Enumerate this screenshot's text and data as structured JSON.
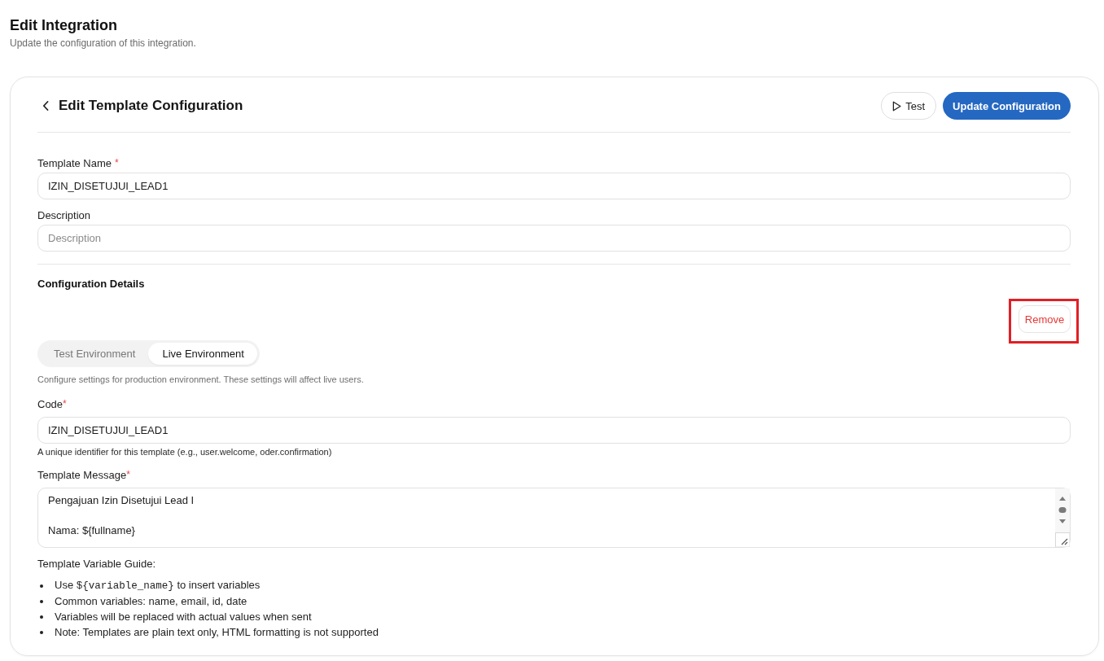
{
  "page": {
    "title": "Edit Integration",
    "subtitle": "Update the configuration of this integration."
  },
  "card": {
    "title": "Edit Template Configuration",
    "buttons": [
      {
        "kind": "test",
        "label": "Test"
      },
      {
        "kind": "primary",
        "label": "Update Configuration"
      }
    ],
    "fields": [
      {
        "label": "Template Name",
        "required_mark": "*",
        "value": "IZIN_DISETUJUI_LEAD1"
      },
      {
        "label": "Description",
        "placeholder": "Description"
      }
    ],
    "configuration": {
      "heading": "Configuration Details",
      "remove_button": {
        "label": "Remove",
        "highlighted": true
      },
      "environment_tabs": [
        {
          "label": "Test Environment",
          "selected": false
        },
        {
          "label": "Live Environment",
          "selected": true
        }
      ],
      "environment_note": "Configure settings for production environment. These settings will affect live users.",
      "code": {
        "label": "Code",
        "required_mark": "*",
        "value": "IZIN_DISETUJUI_LEAD1",
        "hint": "A unique identifier for this template (e.g., user.welcome, oder.confirmation)"
      },
      "template_message": {
        "label": "Template Message",
        "required_mark": "*",
        "value": "Pengajuan Izin Disetujui Lead I\n\nNama: ${fullname}"
      },
      "variable_guide": {
        "heading": "Template Variable Guide:",
        "items": [
          {
            "segments": [
              {
                "kind": "text",
                "text": "Use "
              },
              {
                "kind": "code",
                "text": "${variable_name}"
              },
              {
                "kind": "text",
                "text": " to insert variables"
              }
            ]
          },
          {
            "segments": [
              {
                "kind": "text",
                "text": "Common variables: name, email, id, date"
              }
            ]
          },
          {
            "segments": [
              {
                "kind": "text",
                "text": "Variables will be replaced with actual values when sent"
              }
            ]
          },
          {
            "segments": [
              {
                "kind": "text",
                "text": "Note: Templates are plain text only, HTML formatting is not supported"
              }
            ]
          }
        ]
      }
    }
  }
}
